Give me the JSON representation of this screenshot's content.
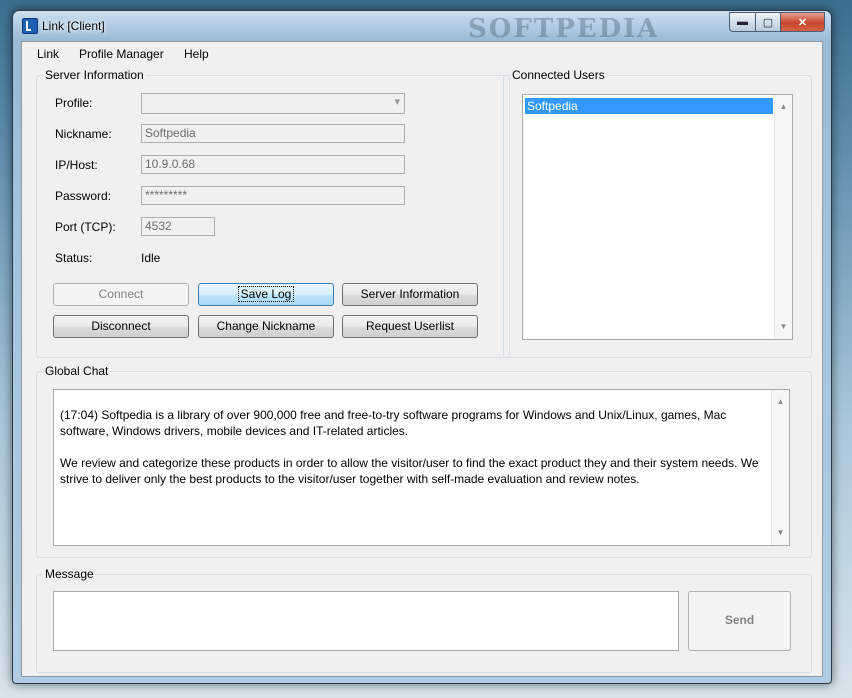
{
  "window": {
    "title": "Link [Client]",
    "watermark": "SOFTPEDIA"
  },
  "caption_buttons": {
    "minimize": "▬",
    "maximize": "▢",
    "close": "✕"
  },
  "menu": [
    "Link",
    "Profile Manager",
    "Help"
  ],
  "server_info": {
    "legend": "Server Information",
    "profile_label": "Profile:",
    "profile_value": "",
    "nickname_label": "Nickname:",
    "nickname_value": "Softpedia",
    "host_label": "IP/Host:",
    "host_value": "10.9.0.68",
    "password_label": "Password:",
    "password_value": "*********",
    "port_label": "Port (TCP):",
    "port_value": "4532",
    "status_label": "Status:",
    "status_value": "Idle"
  },
  "buttons": {
    "connect": "Connect",
    "save_log": "Save Log",
    "server_information": "Server Information",
    "disconnect": "Disconnect",
    "change_nickname": "Change Nickname",
    "request_userlist": "Request Userlist",
    "send": "Send"
  },
  "connected_users": {
    "legend": "Connected Users",
    "users": [
      "Softpedia"
    ]
  },
  "global_chat": {
    "legend": "Global Chat",
    "messages": [
      "(17:04) Softpedia is a library of over 900,000 free and free-to-try software programs for Windows and Unix/Linux, games, Mac software, Windows drivers, mobile devices and IT-related articles.",
      "We review and categorize these products in order to allow the visitor/user to find the exact product they and their system needs. We strive to deliver only the best products to the visitor/user together with self-made evaluation and review notes."
    ]
  },
  "message": {
    "legend": "Message",
    "value": ""
  }
}
